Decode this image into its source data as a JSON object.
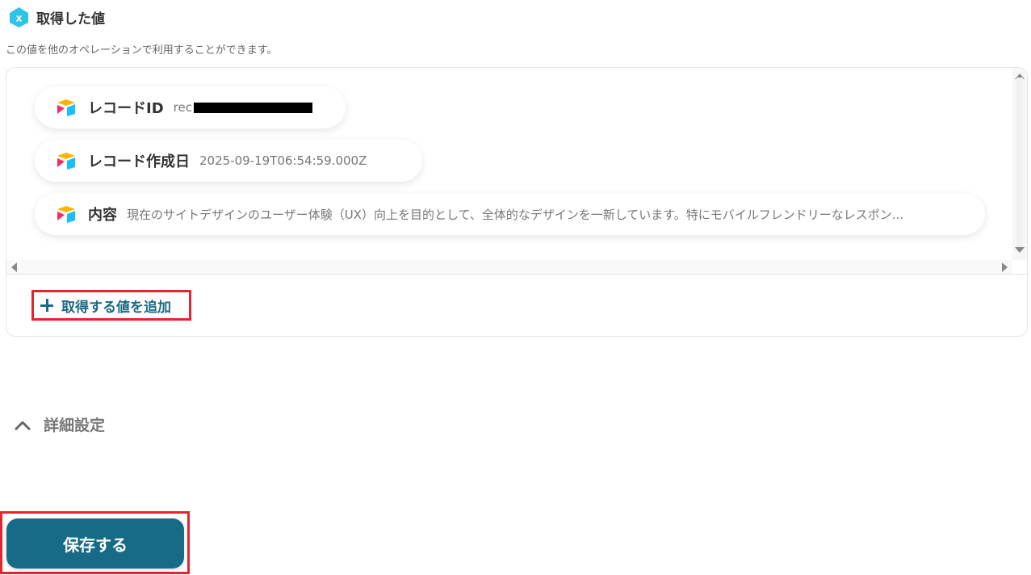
{
  "header": {
    "title": "取得した値",
    "icon": "variable-x-icon",
    "icon_color": "#2ec4e8"
  },
  "description": "この値を他のオペレーションで利用することができます。",
  "values": [
    {
      "label": "レコードID",
      "value": "rec",
      "redacted": true,
      "icon": "airtable-icon"
    },
    {
      "label": "レコード作成日",
      "value": "2025-09-19T06:54:59.000Z",
      "icon": "airtable-icon"
    },
    {
      "label": "内容",
      "value": "現在のサイトデザインのユーザー体験（UX）向上を目的として、全体的なデザインを一新しています。特にモバイルフレンドリーなレスポン...",
      "icon": "airtable-icon"
    }
  ],
  "add_button": {
    "label": "取得する値を追加",
    "icon": "plus-icon"
  },
  "advanced": {
    "label": "詳細設定",
    "icon": "chevron-up-icon"
  },
  "save_button": {
    "label": "保存する"
  },
  "colors": {
    "accent": "#186b86",
    "highlight": "#e0262f",
    "link": "#1a6a83"
  }
}
